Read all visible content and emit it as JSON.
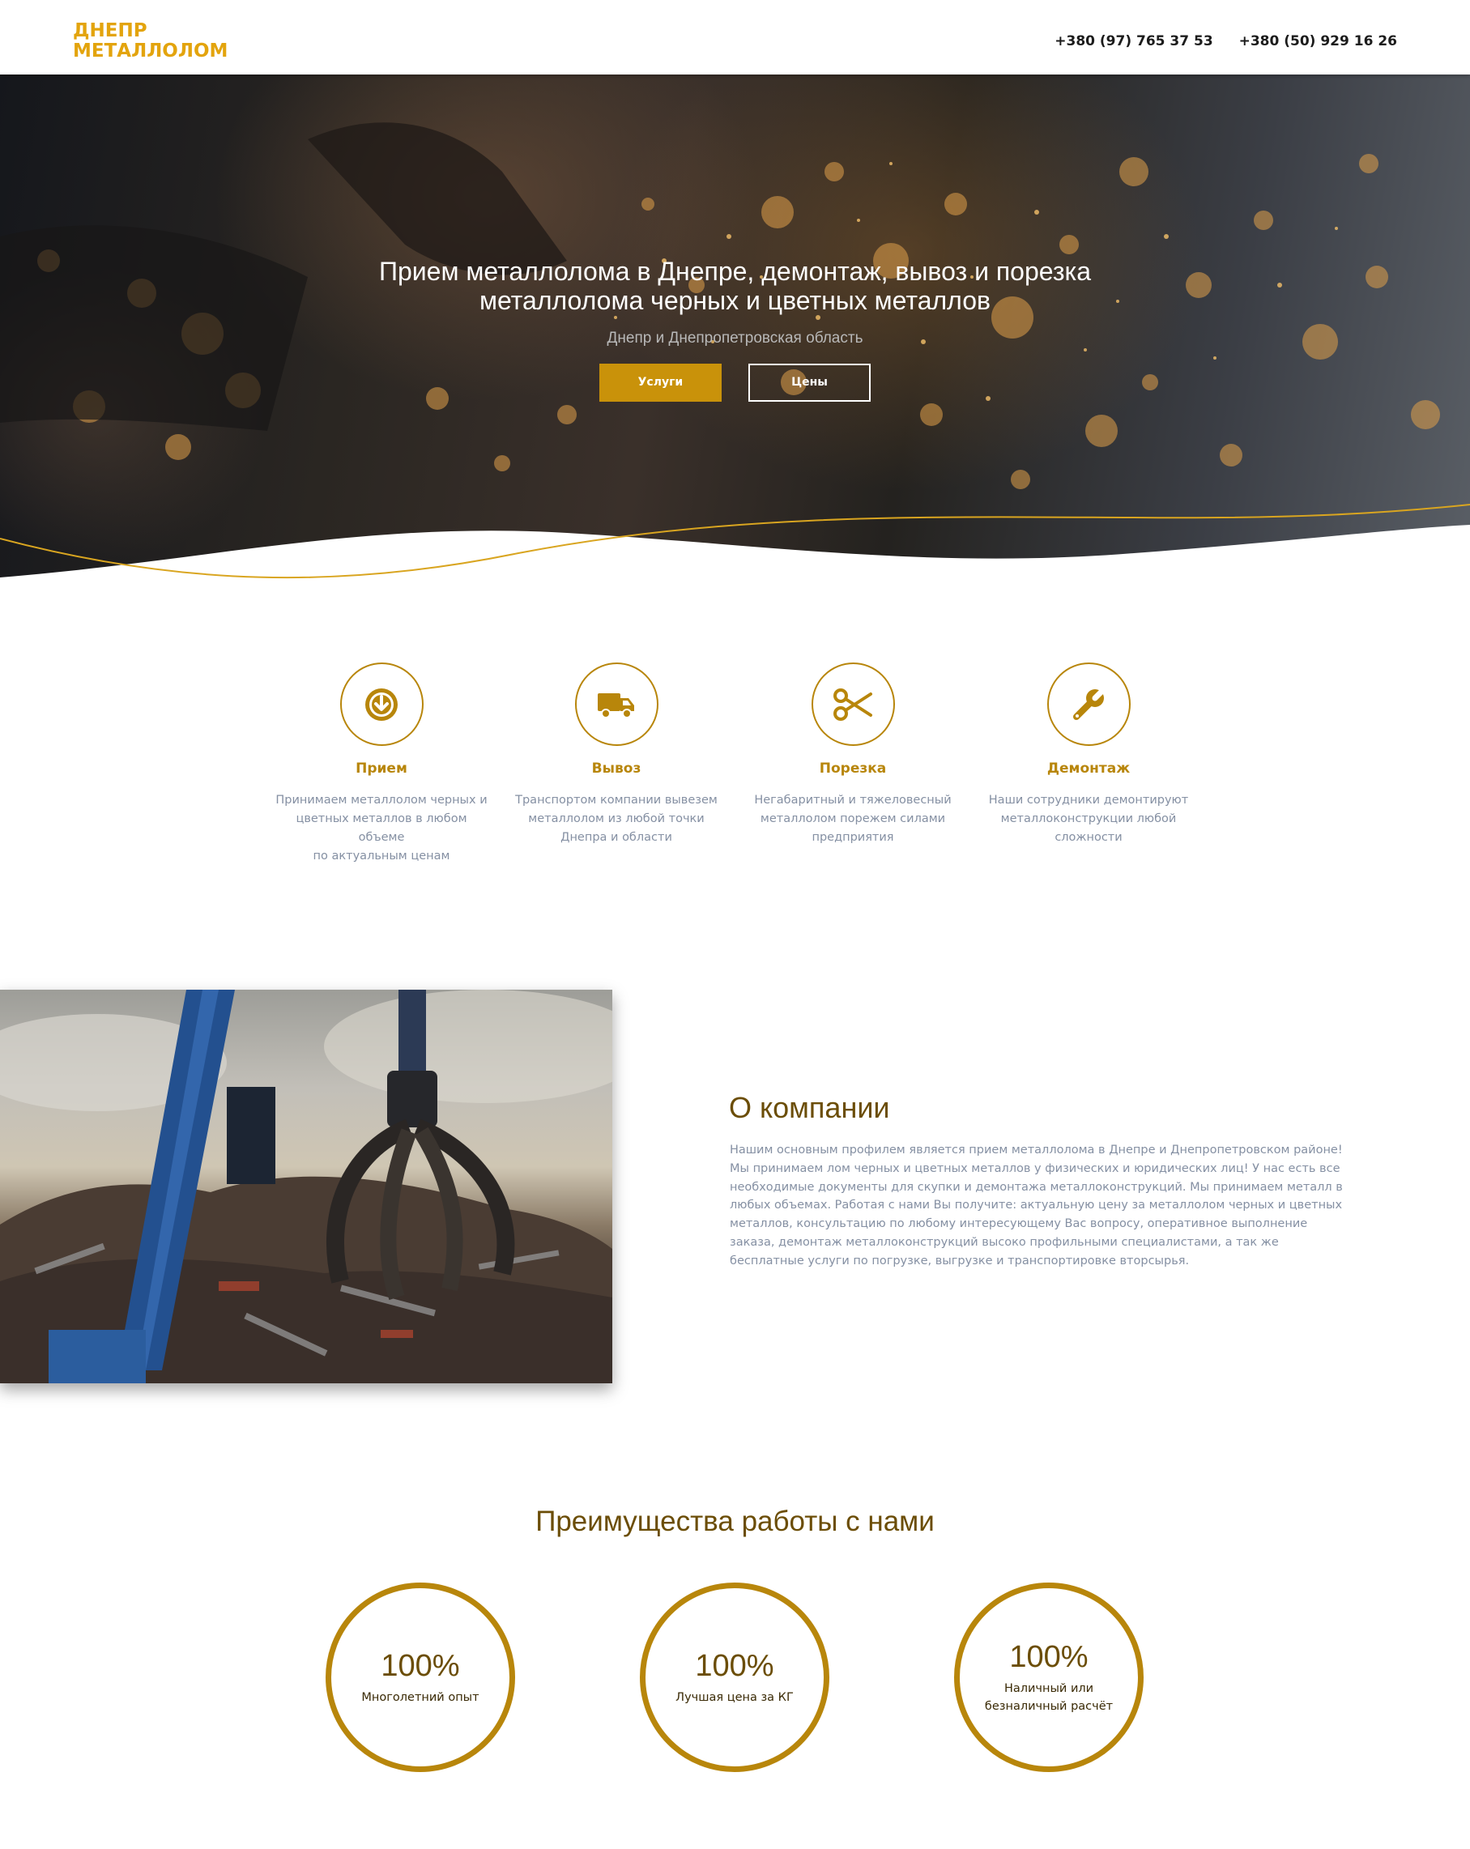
{
  "header": {
    "logo_line1": "ДНЕПР",
    "logo_line2": "МЕТАЛЛОЛОМ",
    "phone1": "+380 (97) 765 37 53",
    "phone2": "+380 (50) 929 16 26"
  },
  "hero": {
    "title": "Прием металлолома в Днепре, демонтаж, вывоз и порезка металлолома черных и цветных металлов",
    "subtitle": "Днепр и Днепропетровская область",
    "btn_services": "Услуги",
    "btn_prices": "Цены"
  },
  "services": [
    {
      "title": "Прием",
      "icon": "download-circle-icon",
      "lines": [
        "Принимаем металлолом черных и",
        "цветных металлов в любом",
        "объеме",
        "по актуальным ценам"
      ]
    },
    {
      "title": "Вывоз",
      "icon": "truck-icon",
      "lines": [
        "Транспортом компании вывезем",
        "металлолом из любой точки",
        "Днепра и области"
      ]
    },
    {
      "title": "Порезка",
      "icon": "scissors-icon",
      "lines": [
        "Негабаритный и тяжеловесный",
        "металлолом порежем силами",
        "предприятия"
      ]
    },
    {
      "title": "Демонтаж",
      "icon": "wrench-icon",
      "lines": [
        "Наши сотрудники демонтируют",
        "металлоконструкции любой",
        "сложности"
      ]
    }
  ],
  "about": {
    "title": "О компании",
    "text": "Нашим основным профилем является прием металлолома в Днепре и Днепропетровском районе! Мы принимаем лом черных и цветных металлов у физических и юридических лиц! У нас есть все необходимые документы для скупки и демонтажа металлоконструкций. Мы принимаем металл в любых объемах. Работая с нами Вы получите: актуальную цену за металлолом черных и цветных металлов, консультацию по любому интересующему Вас вопросу, оперативное выполнение заказа, демонтаж металлоконструкций высоко профильными специалистами, а так же бесплатные услуги по погрузке, выгрузке и транспортировке вторсырья."
  },
  "advantages": {
    "title": "Преимущества работы с нами",
    "items": [
      {
        "value": "100%",
        "lines": [
          "Многолетний опыт"
        ]
      },
      {
        "value": "100%",
        "lines": [
          "Лучшая цена за КГ"
        ]
      },
      {
        "value": "100%",
        "lines": [
          "Наличный или",
          "безналичный расчёт"
        ]
      }
    ]
  },
  "colors": {
    "accent": "#b8860b",
    "logo": "#e3a40d",
    "heading": "#6b4d06",
    "muted_text": "#8590a3"
  }
}
